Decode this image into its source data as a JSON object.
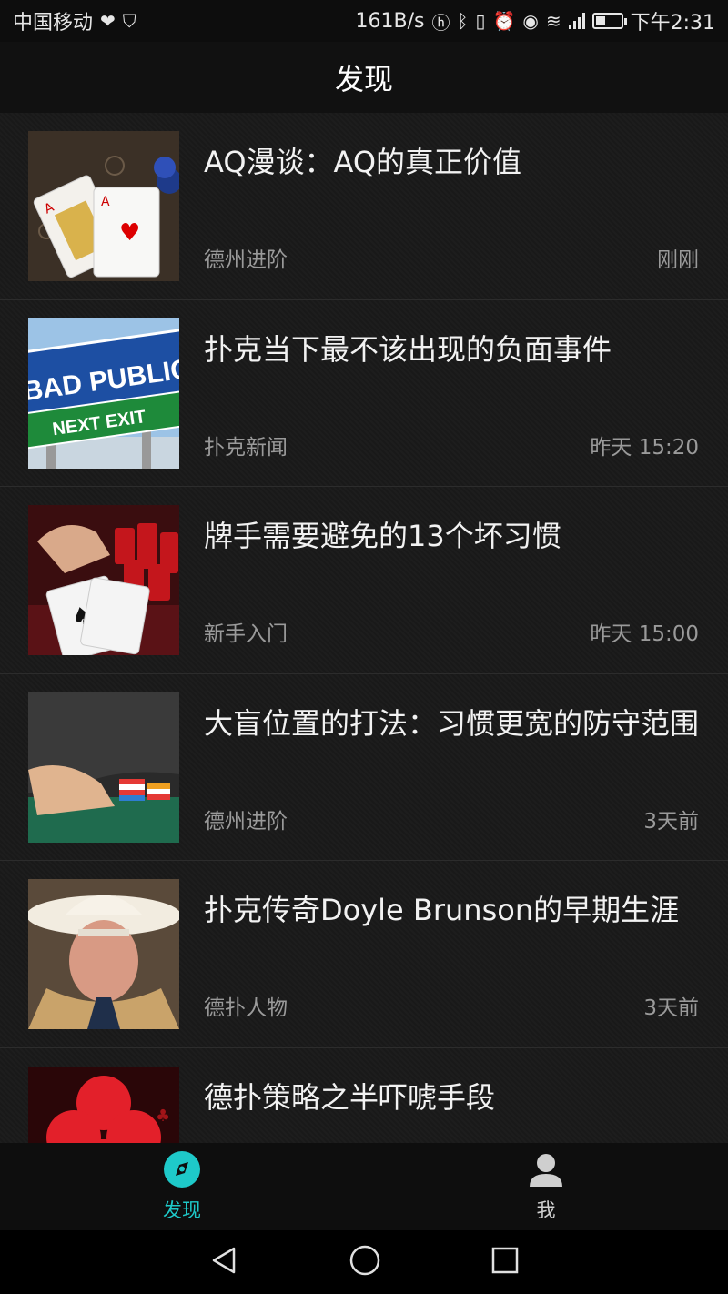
{
  "status_bar": {
    "carrier": "中国移动",
    "net_speed": "161B/s",
    "time": "下午2:31",
    "battery_level": 0.4,
    "icons": [
      "heart-icon",
      "shield-icon",
      "hd-icon",
      "bluetooth-icon",
      "vibrate-icon",
      "alarm-icon",
      "eye-icon",
      "wifi-icon",
      "4g-signal-icon",
      "battery-icon"
    ]
  },
  "header": {
    "title": "发现"
  },
  "articles": [
    {
      "title": "AQ漫谈：AQ的真正价值",
      "category": "德州进阶",
      "time": "刚刚",
      "thumb": "playing-cards-image"
    },
    {
      "title": "扑克当下最不该出现的负面事件",
      "category": "扑克新闻",
      "time": "昨天 15:20",
      "thumb": "bad-publicity-sign-image",
      "sign_top": "BAD PUBLICITY",
      "sign_bottom": "NEXT EXIT"
    },
    {
      "title": "牌手需要避免的13个坏习惯",
      "category": "新手入门",
      "time": "昨天 15:00",
      "thumb": "hand-cards-chips-image"
    },
    {
      "title": "大盲位置的打法：习惯更宽的防守范围",
      "category": "德州进阶",
      "time": "3天前",
      "thumb": "poker-table-chips-image"
    },
    {
      "title": "扑克传奇Doyle Brunson的早期生涯",
      "category": "德扑人物",
      "time": "3天前",
      "thumb": "cowboy-portrait-image"
    },
    {
      "title": "德扑策略之半吓唬手段",
      "category": "",
      "time": "",
      "thumb": "red-club-suit-image"
    }
  ],
  "bottom_nav": {
    "tabs": [
      {
        "label": "发现",
        "icon": "compass-icon",
        "active": true
      },
      {
        "label": "我",
        "icon": "user-icon",
        "active": false
      }
    ],
    "active_color": "#1ec9c9"
  },
  "system_nav": {
    "icons": [
      "back-icon",
      "home-icon",
      "recents-icon"
    ]
  }
}
